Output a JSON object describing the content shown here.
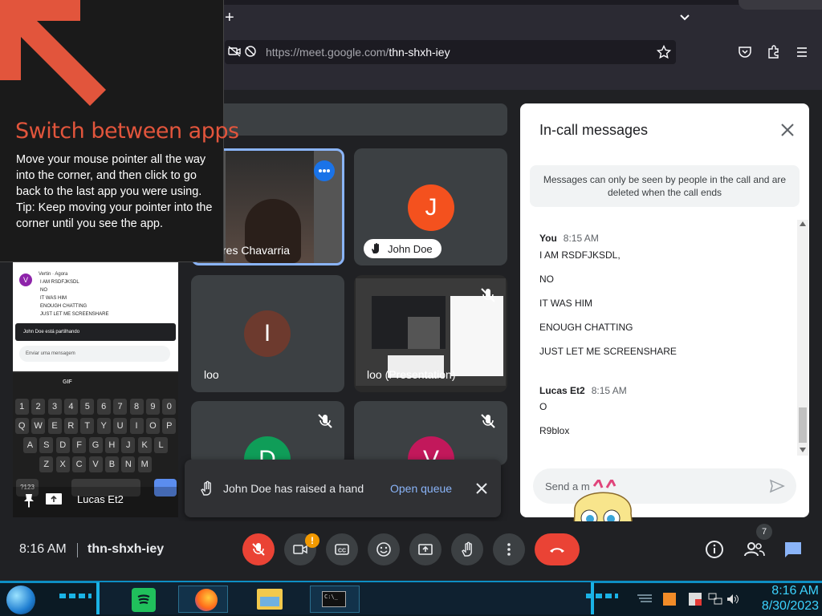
{
  "browser": {
    "url_host": "https://meet.google.com/",
    "url_path": "thn-shxh-iey",
    "new_tab": "+"
  },
  "tip": {
    "title": "Switch between apps",
    "body": "Move your mouse pointer all the way into the corner, and then click to go back to the last app you were using.",
    "tip": "Tip: Keep moving your pointer into the corner until you see the app."
  },
  "tiles": {
    "t1_name": "res Chavarria",
    "t2_name": "John Doe",
    "t2_initial": "J",
    "t3_name": "loo",
    "t3_initial": "I",
    "t4_name": "loo (Presentation)",
    "t5_initial": "D",
    "t6_initial": "V"
  },
  "chat": {
    "title": "In-call messages",
    "info": "Messages can only be seen by people in the call and are deleted when the call ends",
    "groups": [
      {
        "sender": "You",
        "time": "8:15 AM",
        "messages": [
          "I AM RSDFJKSDL,",
          "NO",
          "IT WAS HIM",
          "ENOUGH CHATTING",
          "JUST LET ME SCREENSHARE"
        ]
      },
      {
        "sender": "Lucas Et2",
        "time": "8:15 AM",
        "messages": [
          "O",
          "R9blox"
        ]
      }
    ],
    "send_placeholder": "Send a m"
  },
  "toast": {
    "text": "John Doe has raised a hand",
    "action": "Open queue"
  },
  "phone": {
    "sender": "Vertin",
    "sender_time": "· Agora",
    "lines": [
      "I AM RSDFJKSDL",
      "NO",
      "IT WAS HIM",
      "ENOUGH CHATTING",
      "JUST LET ME SCREENSHARE"
    ],
    "notice": "John Doe está partilhando",
    "input_placeholder": "Enviar uma mensagem",
    "name": "Lucas Et2",
    "kb_row1": [
      "1",
      "2",
      "3",
      "4",
      "5",
      "6",
      "7",
      "8",
      "9",
      "0"
    ],
    "kb_row2": [
      "Q",
      "W",
      "E",
      "R",
      "T",
      "Y",
      "U",
      "I",
      "O",
      "P"
    ],
    "kb_row3": [
      "A",
      "S",
      "D",
      "F",
      "G",
      "H",
      "J",
      "K",
      "L"
    ],
    "kb_row4": [
      "Z",
      "X",
      "C",
      "V",
      "B",
      "N",
      "M"
    ],
    "kb_sym": "?123",
    "kb_gif": "GIF"
  },
  "meeting": {
    "time": "8:16 AM",
    "code": "thn-shxh-iey",
    "people_count": "7",
    "alert_badge": "!"
  },
  "taskbar": {
    "time": "8:16 AM",
    "date": "8/30/2023"
  },
  "colors": {
    "accent_red": "#ea4335",
    "tip_orange": "#e2553c",
    "meet_blue": "#8ab4f8",
    "taskbar_cyan": "#3cd3ff"
  }
}
